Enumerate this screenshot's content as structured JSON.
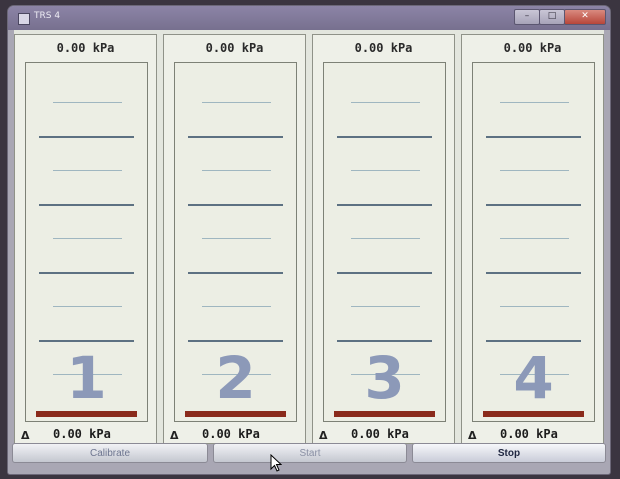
{
  "window": {
    "title": "TRS 4",
    "buttons": {
      "minimize": "–",
      "maximize": "□",
      "close": "✕"
    }
  },
  "channels": [
    {
      "number": "1",
      "reading": "0.00 kPa",
      "delta_symbol": "Δ",
      "delta_reading": "0.00 kPa"
    },
    {
      "number": "2",
      "reading": "0.00 kPa",
      "delta_symbol": "Δ",
      "delta_reading": "0.00 kPa"
    },
    {
      "number": "3",
      "reading": "0.00 kPa",
      "delta_symbol": "Δ",
      "delta_reading": "0.00 kPa"
    },
    {
      "number": "4",
      "reading": "0.00 kPa",
      "delta_symbol": "Δ",
      "delta_reading": "0.00 kPa"
    }
  ],
  "actions": {
    "calibrate_label": "Calibrate",
    "start_label": "Start",
    "stop_label": "Stop"
  },
  "colors": {
    "level_bar": "#8a2a1b",
    "channel_number": "#8c99b8",
    "gauge_major_line": "#5d7182",
    "gauge_minor_line": "#9fb6c0"
  }
}
